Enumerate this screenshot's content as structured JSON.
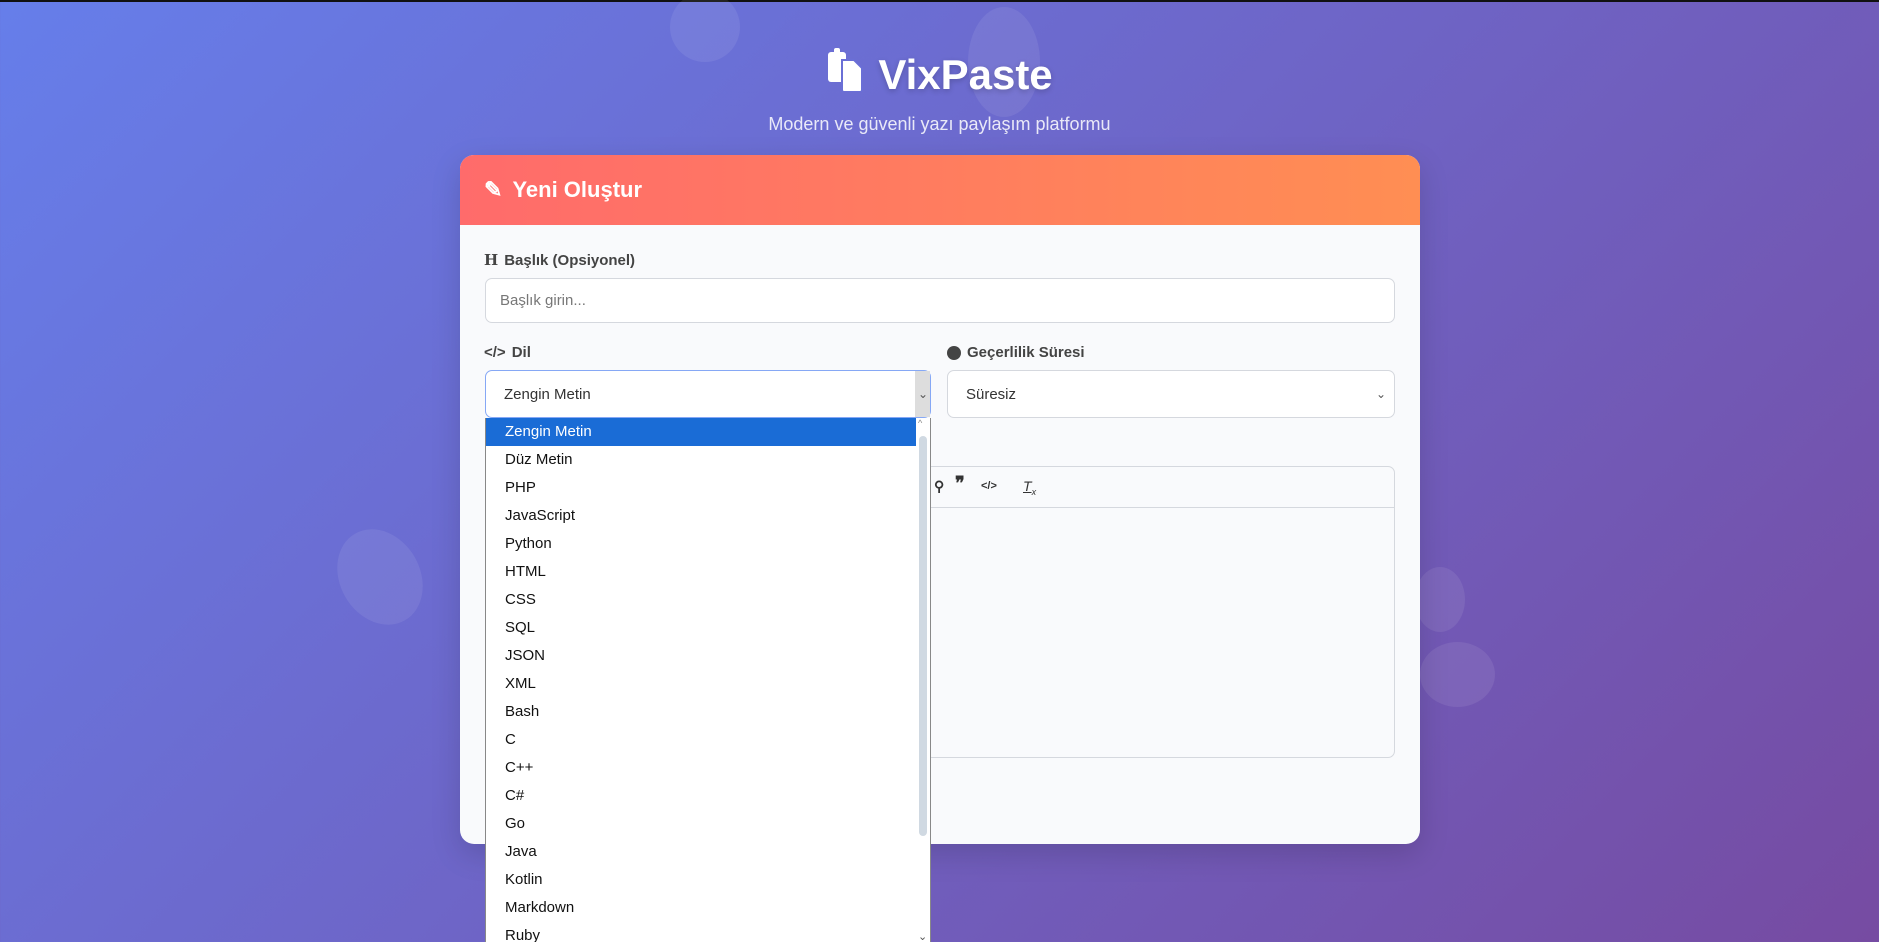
{
  "brand": {
    "title": "VixPaste",
    "subtitle": "Modern ve güvenli yazı paylaşım platformu"
  },
  "card": {
    "title": "Yeni Oluştur"
  },
  "form": {
    "title_label": "Başlık (Opsiyonel)",
    "title_placeholder": "Başlık girin...",
    "language_label": "Dil",
    "language_value": "Zengin Metin",
    "expiry_label": "Geçerlilik Süresi",
    "expiry_value": "Süresiz"
  },
  "dropdown": {
    "options": [
      "Zengin Metin",
      "Düz Metin",
      "PHP",
      "JavaScript",
      "Python",
      "HTML",
      "CSS",
      "SQL",
      "JSON",
      "XML",
      "Bash",
      "C",
      "C++",
      "C#",
      "Go",
      "Java",
      "Kotlin",
      "Markdown",
      "Ruby"
    ],
    "selected": "Zengin Metin"
  },
  "colors": {
    "accent": "#1a6cd6",
    "header_start": "#ff6b6b",
    "header_end": "#ff8e53"
  }
}
